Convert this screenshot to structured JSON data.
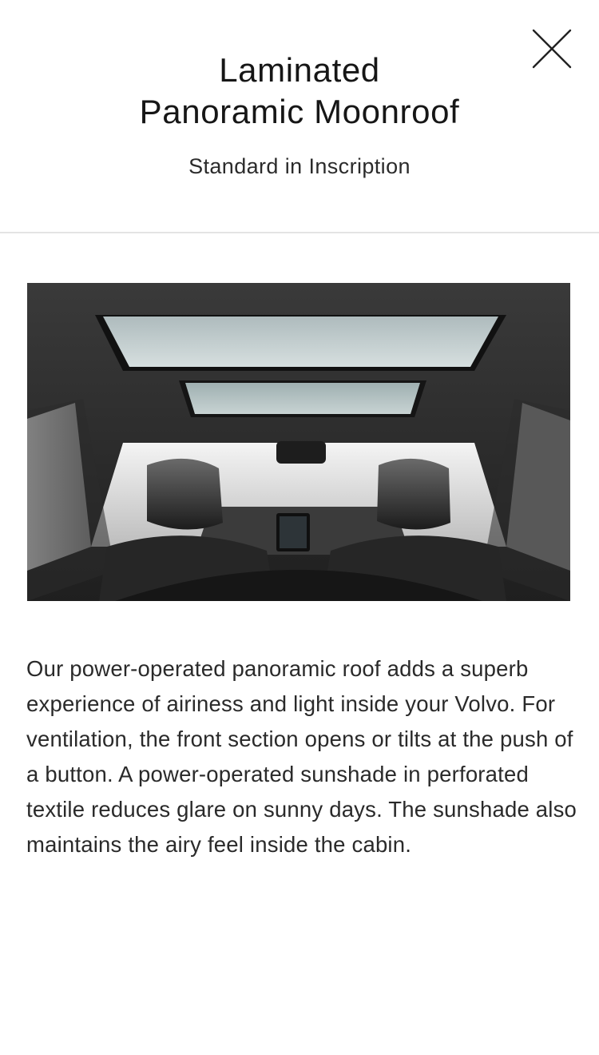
{
  "modal": {
    "title_line1": "Laminated",
    "title_line2": "Panoramic Moonroof",
    "subtitle": "Standard in Inscription",
    "close_icon": "close-icon",
    "image_subject": "panoramic-moonroof-interior-photo",
    "description": "Our power-operated panoramic roof adds a superb experience of airiness and light inside your Volvo. For ventilation, the front section opens or tilts at the push of a button. A power-operated sunshade in perforated textile reduces glare on sunny days. The sunshade also maintains the airy feel inside the cabin."
  },
  "colors": {
    "background": "#ffffff",
    "text": "#141414",
    "divider": "#e4e4e4"
  }
}
